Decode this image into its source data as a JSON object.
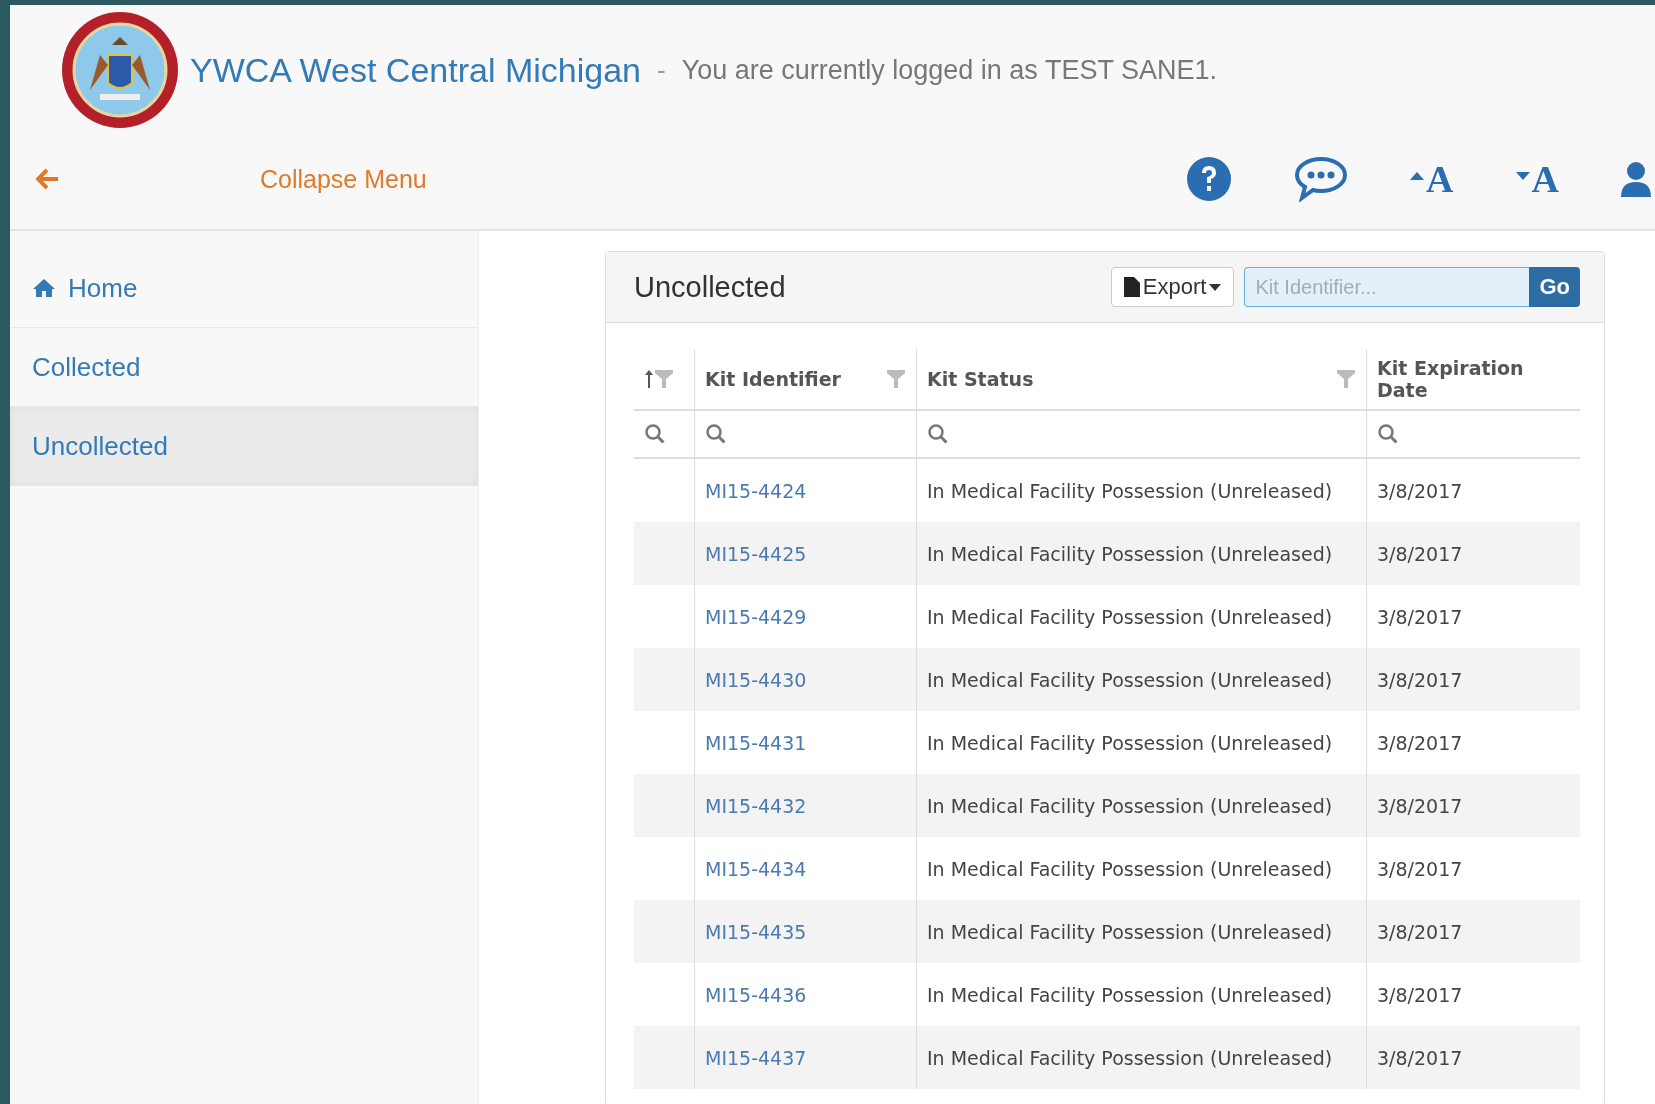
{
  "header": {
    "org_name": "YWCA West Central Michigan",
    "separator": "-",
    "login_text": "You are currently logged in as TEST SANE1."
  },
  "toolbar": {
    "collapse_label": "Collapse Menu",
    "font_buttons": [
      {
        "kind": "increase",
        "label": "A"
      },
      {
        "kind": "decrease",
        "label": "A"
      }
    ]
  },
  "sidebar": {
    "items": [
      {
        "label": "Home",
        "kind": "home",
        "selected": false
      },
      {
        "label": "Collected",
        "kind": "plain",
        "selected": false
      },
      {
        "label": "Uncollected",
        "kind": "plain",
        "selected": true
      }
    ]
  },
  "panel": {
    "title": "Uncollected",
    "export_label": "Export",
    "search": {
      "placeholder": "Kit Identifier..."
    },
    "go_label": "Go"
  },
  "table": {
    "columns": [
      "Kit Identifier",
      "Kit Status",
      "Kit Expiration Date"
    ],
    "rows": [
      {
        "kit": "MI15-4424",
        "status": "In Medical Facility Possession (Unreleased)",
        "date": "3/8/2017"
      },
      {
        "kit": "MI15-4425",
        "status": "In Medical Facility Possession (Unreleased)",
        "date": "3/8/2017"
      },
      {
        "kit": "MI15-4429",
        "status": "In Medical Facility Possession (Unreleased)",
        "date": "3/8/2017"
      },
      {
        "kit": "MI15-4430",
        "status": "In Medical Facility Possession (Unreleased)",
        "date": "3/8/2017"
      },
      {
        "kit": "MI15-4431",
        "status": "In Medical Facility Possession (Unreleased)",
        "date": "3/8/2017"
      },
      {
        "kit": "MI15-4432",
        "status": "In Medical Facility Possession (Unreleased)",
        "date": "3/8/2017"
      },
      {
        "kit": "MI15-4434",
        "status": "In Medical Facility Possession (Unreleased)",
        "date": "3/8/2017"
      },
      {
        "kit": "MI15-4435",
        "status": "In Medical Facility Possession (Unreleased)",
        "date": "3/8/2017"
      },
      {
        "kit": "MI15-4436",
        "status": "In Medical Facility Possession (Unreleased)",
        "date": "3/8/2017"
      },
      {
        "kit": "MI15-4437",
        "status": "In Medical Facility Possession (Unreleased)",
        "date": "3/8/2017"
      }
    ]
  }
}
